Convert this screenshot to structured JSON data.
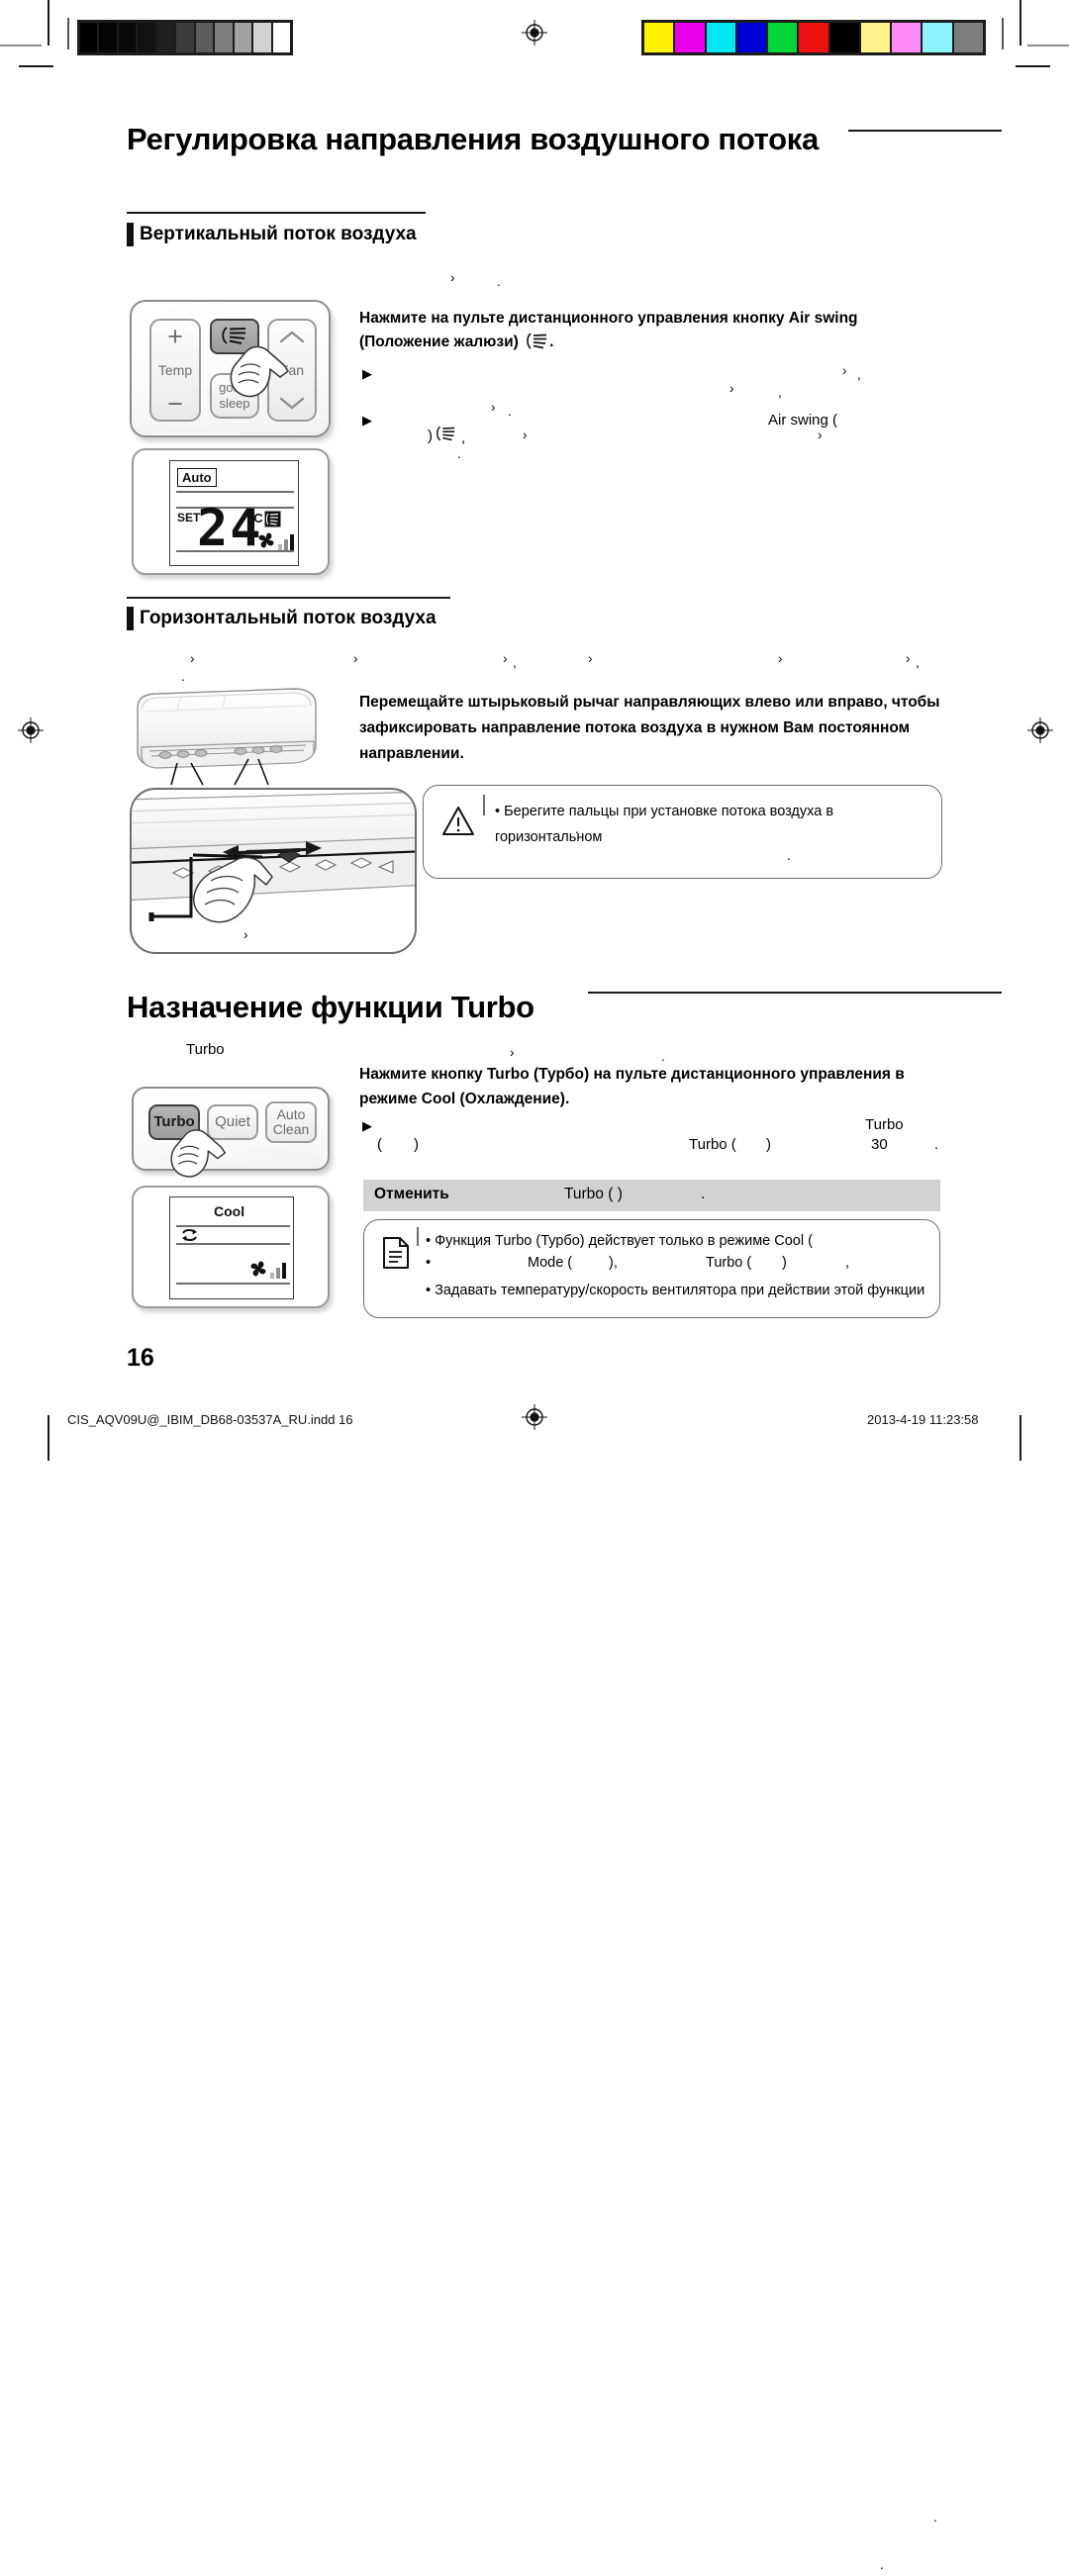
{
  "document": {
    "page_number": "16",
    "footer_file": "CIS_AQV09U@_IBIM_DB68-03537A_RU.indd   16",
    "footer_timestamp": "2013-4-19   11:23:58"
  },
  "calibration": {
    "grayscale_label": "grayscale-calibration-bar",
    "grayscale_swatches": [
      "#000000",
      "#040404",
      "#090909",
      "#121212",
      "#1f1f1f",
      "#3d3d3d",
      "#5c5c5c",
      "#7d7d7d",
      "#a3a3a3",
      "#d2d2d2",
      "#ffffff"
    ],
    "color_label": "color-calibration-bar",
    "color_swatches": [
      "#fff200",
      "#ec00ec",
      "#00e8ef",
      "#0000d4",
      "#00d637",
      "#ee1111",
      "#000000",
      "#fdf28c",
      "#ff8cf4",
      "#8cf2fb",
      "#7d7d7d"
    ]
  },
  "sections": {
    "airflow": {
      "title": "Регулировка направления воздушного потока",
      "vertical": {
        "heading": "Вертикальный поток воздуха",
        "instruction": "Нажмите на пульте дистанционного управления кнопку Air swing (Положение жалюзи)",
        "instruction_tail": ".",
        "bullets": [
          {
            "lead": "",
            "trail_marks": [
              ",",
              ",",
              ","
            ]
          },
          {
            "lead": "",
            "inline": "Air swing ("
          }
        ],
        "fragment_a": ") ",
        "fragment_b": ",",
        "remote": {
          "temp_label": "Temp",
          "plus_label": "+",
          "minus_label": "−",
          "fan_label": "Fan",
          "good_sleep_label_1": "good’",
          "good_sleep_label_2": "sleep",
          "airswing_button": "air-swing-icon",
          "pressed_button": "air-swing-button"
        },
        "lcd": {
          "mode_badge": "Auto",
          "set_label": "SET",
          "temperature": "24",
          "unit": "°C",
          "swing_icon": "air-swing-indicator-icon",
          "fan_icon": "fan-speed-icon"
        }
      },
      "horizontal": {
        "heading": "Горизонтальный поток воздуха",
        "instruction": "Перемещайте штырьковый рычаг направляющих влево или вправо, чтобы зафиксировать направление потока воздуха в нужном Вам постоянном направлении.",
        "caution": {
          "icon": "warning-triangle-icon",
          "text": "Берегите пальцы при установке потока воздуха в горизонтальном"
        }
      }
    },
    "turbo": {
      "title": "Назначение функции Turbo",
      "lead_word": "Turbo",
      "instruction": "Нажмите кнопку Turbo (Турбо) на пульте дистанционного управления в режиме Cool (Охлаждение).",
      "bullet_fragments": {
        "paren_open": "(",
        "paren_close": ")",
        "turbo_paren": "Turbo (",
        "turbo_paren_close": ")",
        "turbo_word": "Turbo",
        "minutes": "30",
        "period": "."
      },
      "cancel_band": {
        "label": "Отменить",
        "value": "Turbo (          )",
        "trail": "."
      },
      "remote": {
        "turbo_label": "Turbo",
        "quiet_label": "Quiet",
        "autoclean_label_1": "Auto",
        "autoclean_label_2": "Clean"
      },
      "lcd": {
        "mode_text": "Cool",
        "turbo_icon": "turbo-indicator-icon",
        "fan_icon": "fan-speed-icon"
      },
      "note": {
        "icon": "note-document-icon",
        "lines": [
          "Функция Turbo (Турбо) действует только в режиме Cool (",
          ").",
          "Mode (",
          "),",
          "Turbo (",
          ")",
          ",",
          "Задавать температуру/скорость вентилятора при действии этой функции",
          "."
        ],
        "line1": "Функция Turbo (Турбо) действует только в режиме Cool (",
        "line1_close": ").",
        "line2_a": "Mode (",
        "line2_b": "),",
        "line2_c": "Turbo (",
        "line2_d": ")",
        "line2_e": ",",
        "line3": "Задавать температуру/скорость вентилятора при действии этой функции",
        "line4": "."
      }
    }
  }
}
